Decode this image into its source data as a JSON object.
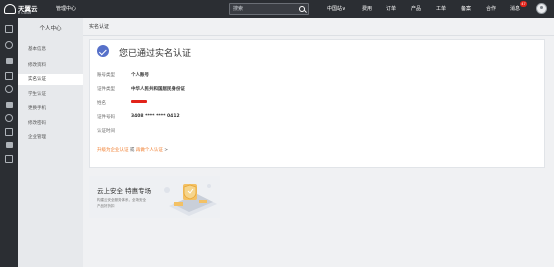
{
  "topbar": {
    "logo_name": "天翼云",
    "logo_sub": "e Cloud",
    "console_label": "管理中心",
    "search_placeholder": "搜索",
    "nav": [
      "中国站∨",
      "费用",
      "订单",
      "产品",
      "工单",
      "备案",
      "合作",
      "消息"
    ],
    "message_count": "47"
  },
  "iconbar": [
    "cube-icon",
    "globe-icon",
    "cloud-icon",
    "shield-icon",
    "db-icon",
    "upload-icon",
    "disk-icon",
    "list-icon",
    "lock-icon",
    "gear-icon"
  ],
  "sidebar": {
    "title": "个人中心",
    "items": [
      "基本信息",
      "修改资料",
      "实名认证",
      "学生认证",
      "更换手机",
      "修改密码",
      "企业管理"
    ],
    "active_index": 2
  },
  "breadcrumb": "实名认证",
  "card": {
    "heading": "您已通过实名认证",
    "rows": [
      {
        "label": "账号类型",
        "value": "个人账号"
      },
      {
        "label": "证件类型",
        "value": "中华人民共和国居民身份证"
      },
      {
        "label": "姓名",
        "value": ""
      },
      {
        "label": "证件号码",
        "value": "3408 **** **** 0412"
      },
      {
        "label": "认证时间",
        "value": ""
      }
    ],
    "upgrade_link": "升级为企业认证",
    "upgrade_or": " 或 ",
    "personal_link": "再做个人认证",
    "upgrade_arrow": " >"
  },
  "banner": {
    "title": "云上安全 特惠专场",
    "line1": "构建云安全服务体系，全场安全",
    "line2": "产品好折扣"
  },
  "colors": {
    "accent": "#5670c9",
    "link": "#f07c2c",
    "topbar": "#2b2e33",
    "badge": "#e2231a"
  }
}
